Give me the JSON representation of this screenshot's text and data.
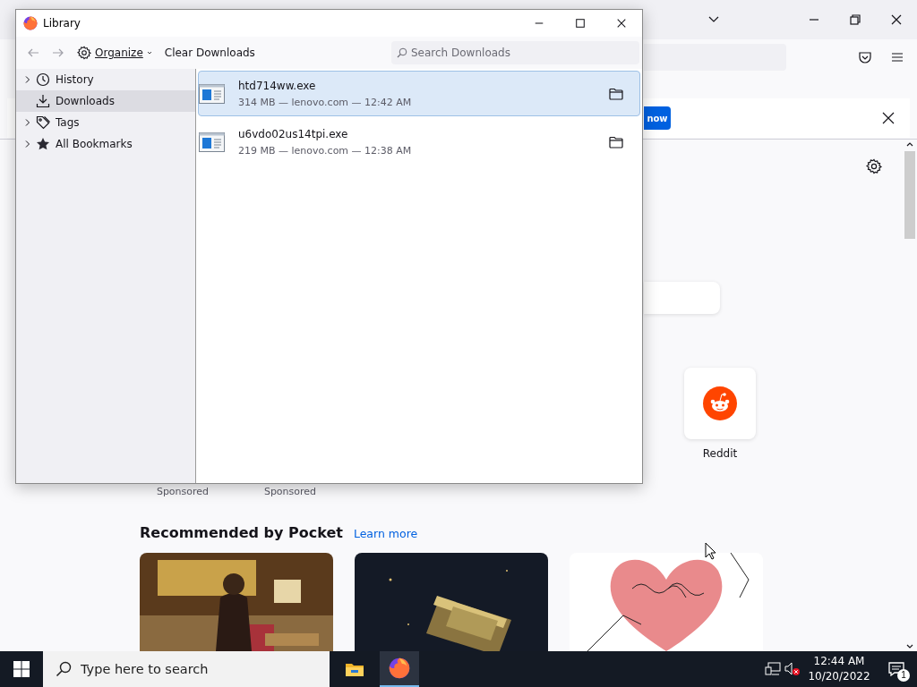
{
  "browser": {
    "notification": {
      "button": "now"
    },
    "top_sites": [
      {
        "kind": "sponsored",
        "caption": "Sponsored"
      },
      {
        "kind": "sponsored",
        "caption": "Sponsored"
      },
      {
        "kind": "site",
        "label": "Reddit"
      }
    ],
    "pocket": {
      "title": "Recommended by Pocket",
      "link": "Learn more"
    }
  },
  "library": {
    "title": "Library",
    "toolbar": {
      "organize": "Organize",
      "clear": "Clear Downloads",
      "search_placeholder": "Search Downloads"
    },
    "sidebar": [
      {
        "label": "History",
        "expandable": true,
        "selected": false
      },
      {
        "label": "Downloads",
        "expandable": false,
        "selected": true
      },
      {
        "label": "Tags",
        "expandable": true,
        "selected": false
      },
      {
        "label": "All Bookmarks",
        "expandable": true,
        "selected": false
      }
    ],
    "downloads": [
      {
        "name": "htd714ww.exe",
        "details": "314 MB — lenovo.com — 12:42 AM",
        "selected": true
      },
      {
        "name": "u6vdo02us14tpi.exe",
        "details": "219 MB — lenovo.com — 12:38 AM",
        "selected": false
      }
    ]
  },
  "taskbar": {
    "search_placeholder": "Type here to search",
    "time": "12:44 AM",
    "date": "10/20/2022",
    "notifications": "1"
  }
}
